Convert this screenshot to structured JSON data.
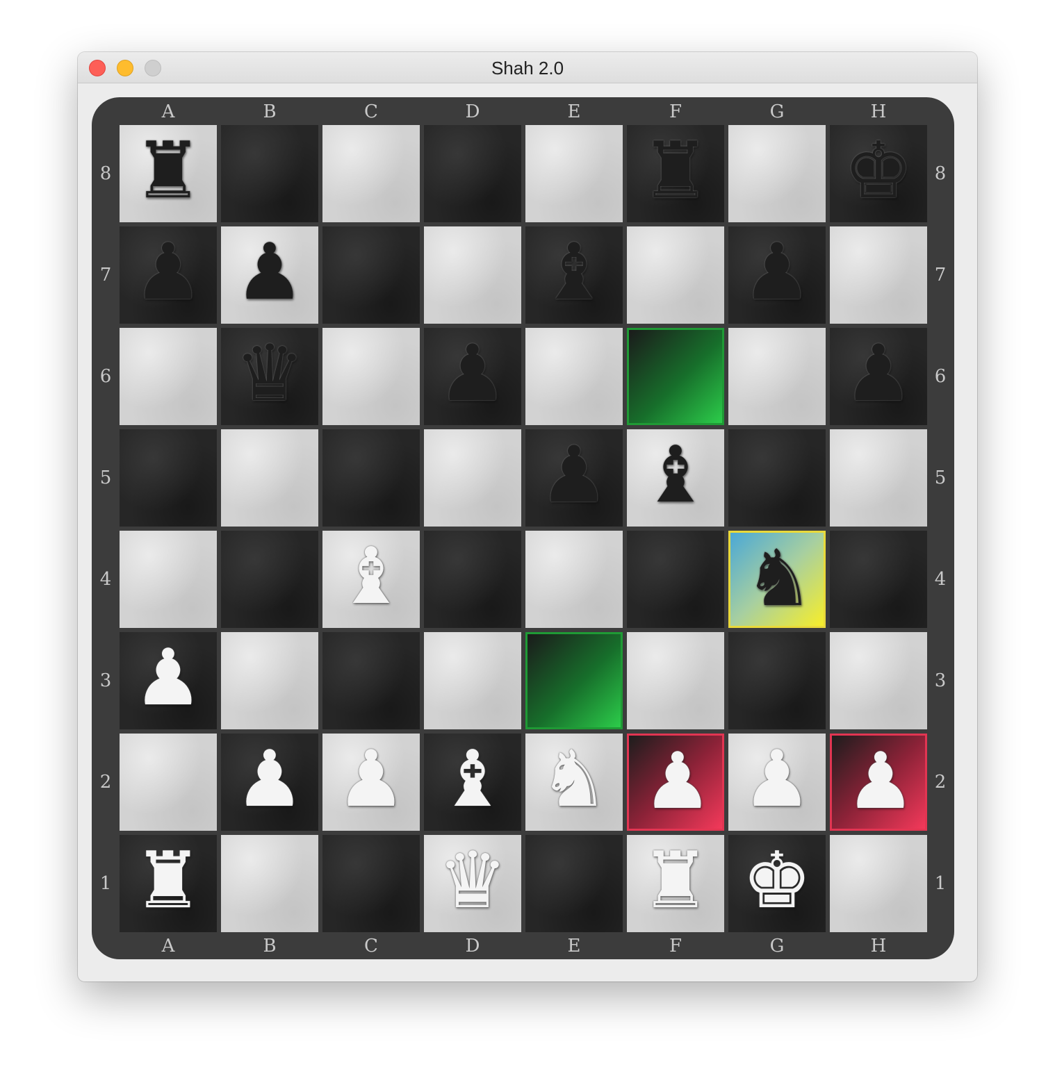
{
  "window": {
    "title": "Shah 2.0"
  },
  "board": {
    "files": [
      "A",
      "B",
      "C",
      "D",
      "E",
      "F",
      "G",
      "H"
    ],
    "ranks": [
      "8",
      "7",
      "6",
      "5",
      "4",
      "3",
      "2",
      "1"
    ],
    "colors": {
      "frame": "#3c3c3c",
      "light_square": "#d2d2d2",
      "dark_square": "#262626",
      "move_highlight": "#2ccc4a",
      "selected_highlight": "#f7ee2a",
      "attack_highlight": "#f3395a"
    },
    "pieces": [
      {
        "square": "a8",
        "color": "black",
        "type": "rook",
        "glyph": "♜"
      },
      {
        "square": "f8",
        "color": "black",
        "type": "rook",
        "glyph": "♜"
      },
      {
        "square": "h8",
        "color": "black",
        "type": "king",
        "glyph": "♚"
      },
      {
        "square": "a7",
        "color": "black",
        "type": "pawn",
        "glyph": "♟"
      },
      {
        "square": "b7",
        "color": "black",
        "type": "pawn",
        "glyph": "♟"
      },
      {
        "square": "e7",
        "color": "black",
        "type": "bishop",
        "glyph": "♝"
      },
      {
        "square": "g7",
        "color": "black",
        "type": "pawn",
        "glyph": "♟"
      },
      {
        "square": "b6",
        "color": "black",
        "type": "queen",
        "glyph": "♛"
      },
      {
        "square": "d6",
        "color": "black",
        "type": "pawn",
        "glyph": "♟"
      },
      {
        "square": "h6",
        "color": "black",
        "type": "pawn",
        "glyph": "♟"
      },
      {
        "square": "e5",
        "color": "black",
        "type": "pawn",
        "glyph": "♟"
      },
      {
        "square": "f5",
        "color": "black",
        "type": "bishop",
        "glyph": "♝"
      },
      {
        "square": "c4",
        "color": "white",
        "type": "bishop",
        "glyph": "♝"
      },
      {
        "square": "g4",
        "color": "black",
        "type": "knight",
        "glyph": "♞"
      },
      {
        "square": "a3",
        "color": "white",
        "type": "pawn",
        "glyph": "♟"
      },
      {
        "square": "b2",
        "color": "white",
        "type": "pawn",
        "glyph": "♟"
      },
      {
        "square": "c2",
        "color": "white",
        "type": "pawn",
        "glyph": "♟"
      },
      {
        "square": "d2",
        "color": "white",
        "type": "bishop",
        "glyph": "♝"
      },
      {
        "square": "e2",
        "color": "white",
        "type": "knight",
        "glyph": "♞"
      },
      {
        "square": "f2",
        "color": "white",
        "type": "pawn",
        "glyph": "♟"
      },
      {
        "square": "g2",
        "color": "white",
        "type": "pawn",
        "glyph": "♟"
      },
      {
        "square": "h2",
        "color": "white",
        "type": "pawn",
        "glyph": "♟"
      },
      {
        "square": "a1",
        "color": "white",
        "type": "rook",
        "glyph": "♜"
      },
      {
        "square": "d1",
        "color": "white",
        "type": "queen",
        "glyph": "♛"
      },
      {
        "square": "f1",
        "color": "white",
        "type": "rook",
        "glyph": "♜"
      },
      {
        "square": "g1",
        "color": "white",
        "type": "king",
        "glyph": "♚"
      }
    ],
    "highlights": [
      {
        "square": "g4",
        "kind": "selected"
      },
      {
        "square": "f6",
        "kind": "move"
      },
      {
        "square": "e3",
        "kind": "move"
      },
      {
        "square": "f2",
        "kind": "attack"
      },
      {
        "square": "h2",
        "kind": "attack"
      }
    ]
  }
}
